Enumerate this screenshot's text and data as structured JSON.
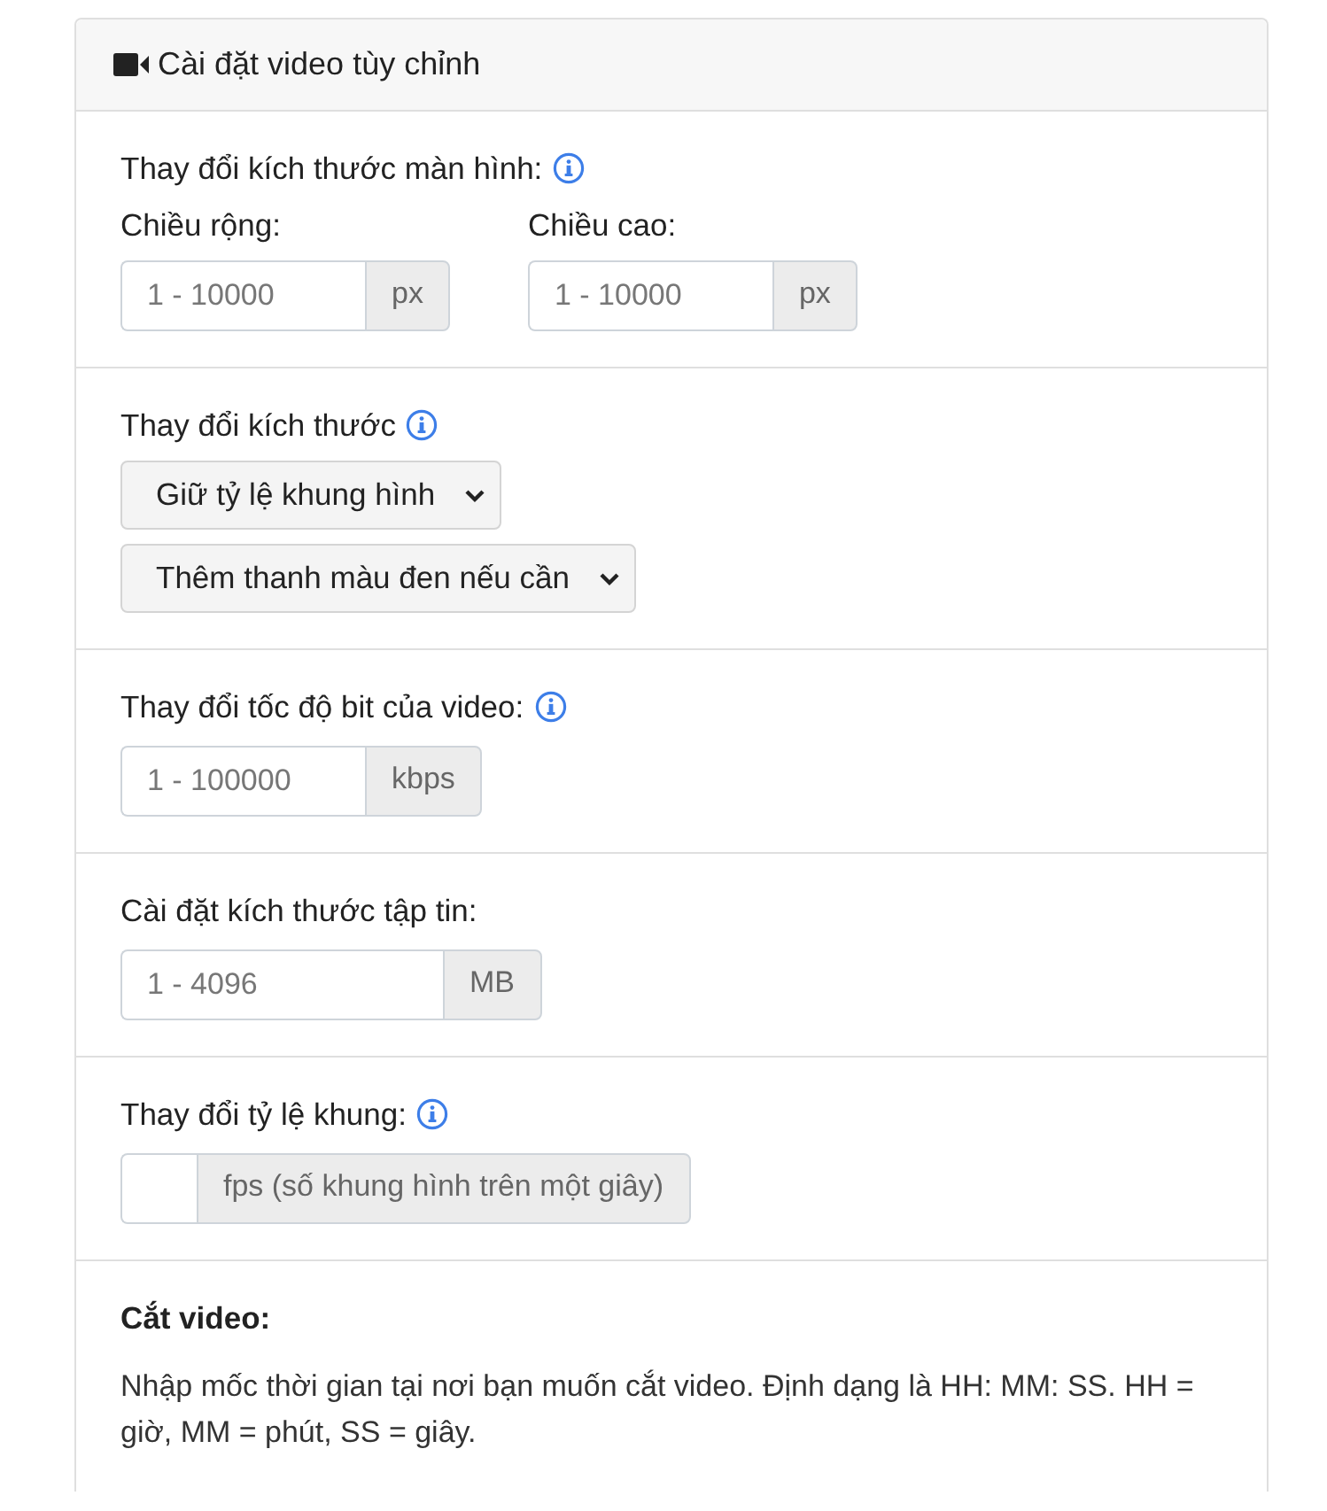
{
  "panel": {
    "title": "Cài đặt video tùy chỉnh"
  },
  "sections": [
    {
      "kind": "dimensions",
      "label": "Thay đổi kích thước màn hình:",
      "info": true,
      "fields": [
        {
          "label": "Chiều rộng:",
          "placeholder": "1 - 10000",
          "unit": "px"
        },
        {
          "label": "Chiều cao:",
          "placeholder": "1 - 10000",
          "unit": "px"
        }
      ]
    },
    {
      "kind": "selects",
      "label": "Thay đổi kích thước",
      "info": true,
      "selects": [
        {
          "value": "Giữ tỷ lệ khung hình"
        },
        {
          "value": "Thêm thanh màu đen nếu cần"
        }
      ]
    },
    {
      "kind": "input",
      "label": "Thay đổi tốc độ bit của video:",
      "info": true,
      "placeholder": "1 - 100000",
      "unit": "kbps"
    },
    {
      "kind": "wide-input",
      "label": "Cài đặt kích thước tập tin:",
      "info": false,
      "placeholder": "1 - 4096",
      "unit": "MB"
    },
    {
      "kind": "narrow-input",
      "label": "Thay đổi tỷ lệ khung:",
      "info": true,
      "unit": "fps (số khung hình trên một giây)"
    },
    {
      "kind": "text",
      "label": "Cắt video:",
      "info": false,
      "text": "Nhập mốc thời gian tại nơi bạn muốn cắt video. Định dạng là HH: MM: SS. HH = giờ, MM = phút, SS = giây."
    }
  ]
}
